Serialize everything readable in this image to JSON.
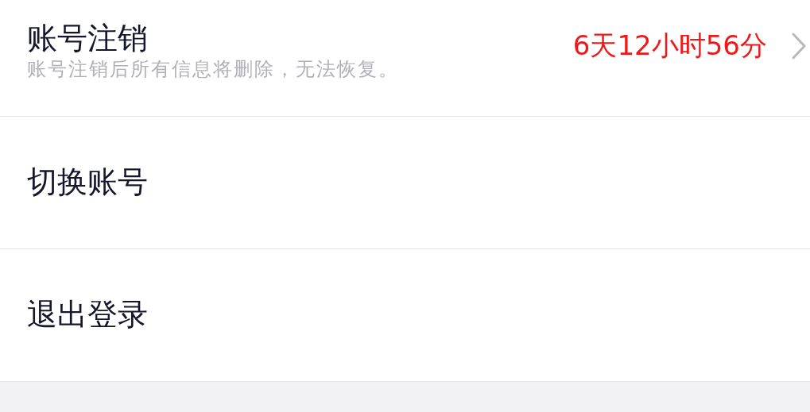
{
  "settings_items": [
    {
      "kind": "detail",
      "title": "账号注销",
      "subtitle": "账号注销后所有信息将删除，无法恢复。",
      "value": "6天12小时56分"
    },
    {
      "kind": "plain",
      "title": "切换账号"
    },
    {
      "kind": "plain",
      "title": "退出登录"
    }
  ]
}
